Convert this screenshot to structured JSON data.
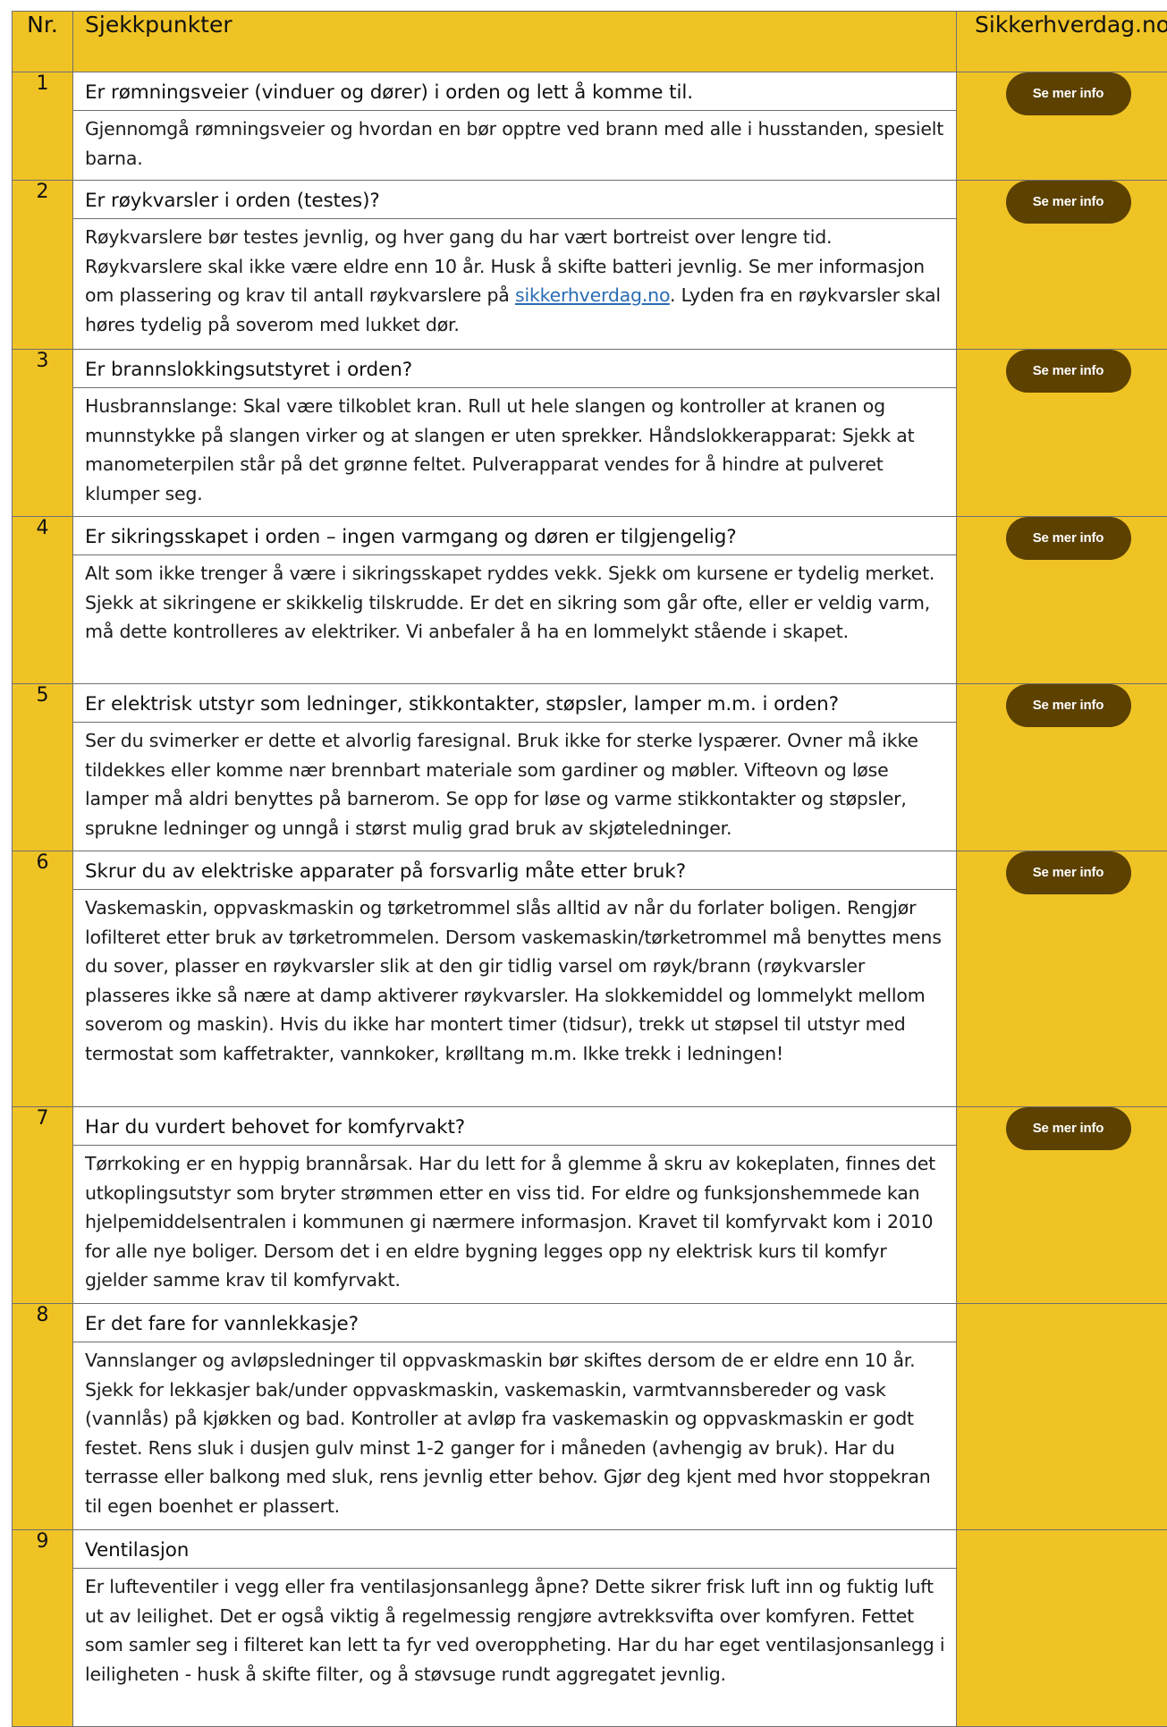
{
  "header": {
    "nr": "Nr.",
    "checkpoints": "Sjekkpunkter",
    "site": "Sikkerhverdag.no"
  },
  "button_label": "Se mer info",
  "colors": {
    "header_yellow": "#f0c325",
    "button_brown": "#5c4100",
    "link_blue": "#2a6db4"
  },
  "items": [
    {
      "nr": "1",
      "title": "Er rømningsveier (vinduer og dører) i orden og lett å komme til.",
      "body": "Gjennomgå rømningsveier og hvordan en bør opptre ved brann med alle i husstanden, spesielt barna.",
      "has_button": true
    },
    {
      "nr": "2",
      "title": "Er røykvarsler i orden (testes)?",
      "body_before_link": "Røykvarslere bør testes jevnlig, og hver gang du har vært bortreist over lengre tid. Røykvarslere skal ikke være eldre enn 10 år. Husk å skifte batteri jevnlig. Se mer informasjon om plassering og krav til antall røykvarslere på ",
      "link_text": "sikkerhverdag.no",
      "body_after_link": ". Lyden fra en røykvarsler skal høres tydelig på soverom med lukket dør.",
      "has_button": true
    },
    {
      "nr": "3",
      "title": "Er brannslokkingsutstyret i orden?",
      "body": "Husbrannslange: Skal være tilkoblet kran. Rull ut hele slangen og kontroller at kranen og munnstykke på slangen virker og at slangen er uten sprekker. Håndslokkerapparat: Sjekk at manometerpilen står på det grønne feltet. Pulverapparat vendes for å hindre at pulveret klumper seg.",
      "has_button": true
    },
    {
      "nr": "4",
      "title": "Er sikringsskapet i orden – ingen varmgang og døren er tilgjengelig?",
      "body": "Alt som ikke trenger å være i sikringsskapet ryddes vekk. Sjekk om kursene er tydelig merket. Sjekk at sikringene er skikkelig tilskrudde. Er det en sikring som går ofte, eller er veldig varm, må dette kontrolleres av elektriker. Vi anbefaler å ha en lommelykt stående i skapet.",
      "has_button": true
    },
    {
      "nr": "5",
      "title": "Er elektrisk utstyr som ledninger, stikkontakter, støpsler, lamper m.m. i orden?",
      "body": "Ser du svimerker er dette et alvorlig faresignal. Bruk ikke for sterke lyspærer. Ovner må ikke tildekkes eller komme nær brennbart materiale som gardiner og møbler. Vifteovn og løse lamper må aldri benyttes på barnerom. Se opp for løse og varme stikkontakter og støpsler, sprukne ledninger og unngå i størst mulig grad bruk av skjøteledninger.",
      "has_button": true
    },
    {
      "nr": "6",
      "title": "Skrur du av elektriske apparater på forsvarlig måte etter bruk?",
      "body": "Vaskemaskin, oppvaskmaskin og tørketrommel slås alltid av når du forlater boligen. Rengjør lofilteret etter bruk av tørketrommelen. Dersom vaskemaskin/tørketrommel må benyttes mens du sover, plasser en røykvarsler slik at den gir tidlig varsel om røyk/brann (røykvarsler plasseres ikke så nære at damp aktiverer røykvarsler. Ha slokkemiddel og lommelykt mellom soverom og maskin). Hvis du ikke har montert timer (tidsur), trekk ut støpsel til utstyr med termostat som kaffetrakter, vannkoker, krølltang m.m. Ikke trekk i ledningen!",
      "has_button": true
    },
    {
      "nr": "7",
      "title": "Har du vurdert behovet for komfyrvakt?",
      "body": "Tørrkoking er en hyppig brannårsak. Har du lett for å glemme å skru av kokeplaten, finnes det utkoplingsutstyr som bryter strømmen etter en viss tid. For eldre og funksjonshemmede kan hjelpemiddelsentralen i kommunen gi nærmere informasjon. Kravet til komfyrvakt kom i 2010 for alle nye boliger. Dersom det i en eldre bygning legges opp ny elektrisk kurs til komfyr gjelder samme krav til komfyrvakt.",
      "has_button": true
    },
    {
      "nr": "8",
      "title": "Er det fare for vannlekkasje?",
      "body": "Vannslanger og avløpsledninger til oppvaskmaskin bør skiftes dersom de er eldre enn 10 år. Sjekk for lekkasjer bak/under oppvaskmaskin, vaskemaskin, varmtvannsbereder og vask (vannlås) på kjøkken og bad. Kontroller at avløp fra vaskemaskin og oppvaskmaskin er godt festet. Rens sluk i dusjen gulv minst 1-2 ganger for i måneden (avhengig av bruk). Har du terrasse eller balkong med sluk, rens jevnlig etter behov. Gjør deg kjent med hvor stoppekran til egen boenhet er plassert.",
      "has_button": false
    },
    {
      "nr": "9",
      "title": "Ventilasjon",
      "body": "Er lufteventiler i vegg eller fra ventilasjonsanlegg åpne? Dette sikrer frisk luft inn og fuktig luft ut av leilighet. Det er også viktig å regelmessig rengjøre avtrekksvifta over komfyren. Fettet som samler seg i filteret kan lett ta fyr ved overoppheting. Har du har eget ventilasjonsanlegg i leiligheten - husk å skifte filter, og å støvsuge rundt aggregatet jevnlig.",
      "has_button": false
    }
  ]
}
